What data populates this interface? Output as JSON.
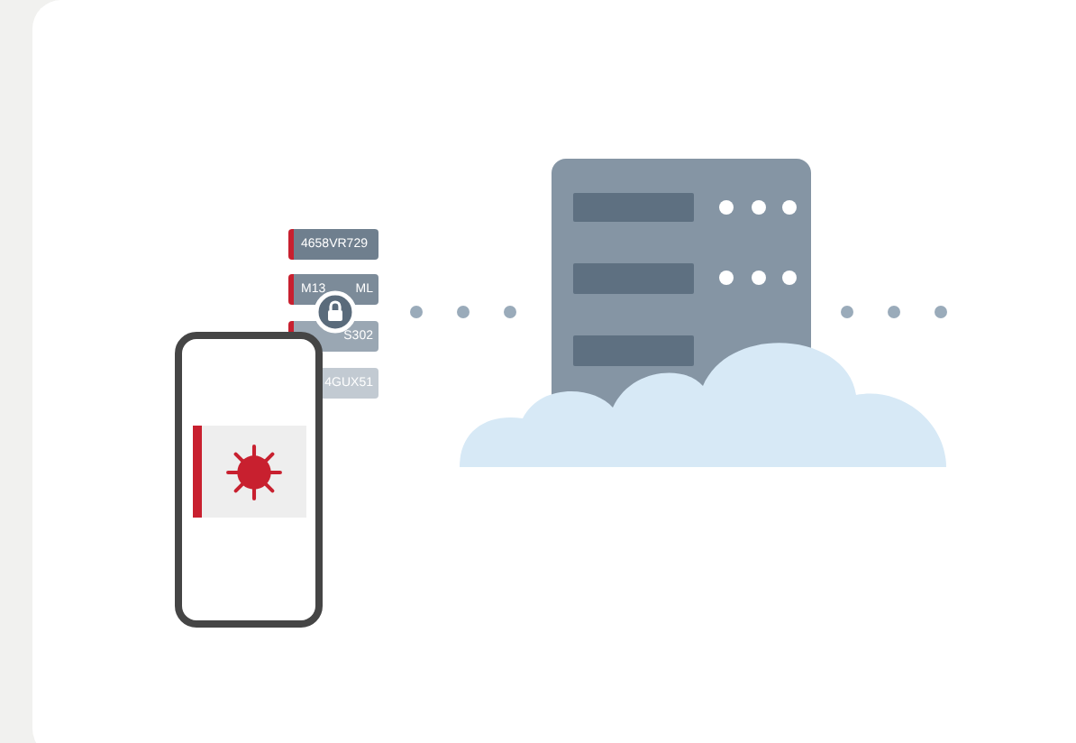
{
  "tags": [
    {
      "parts": [
        "4658VR729"
      ],
      "flagged": true,
      "color": "#6f7f8e"
    },
    {
      "parts": [
        "M13",
        "ML"
      ],
      "flagged": true,
      "color": "#7c8b99"
    },
    {
      "parts": [
        "S302"
      ],
      "flagged": true,
      "color": "#9aa7b3"
    },
    {
      "parts": [
        "4GUX51"
      ],
      "color": "#c2cad2"
    }
  ]
}
